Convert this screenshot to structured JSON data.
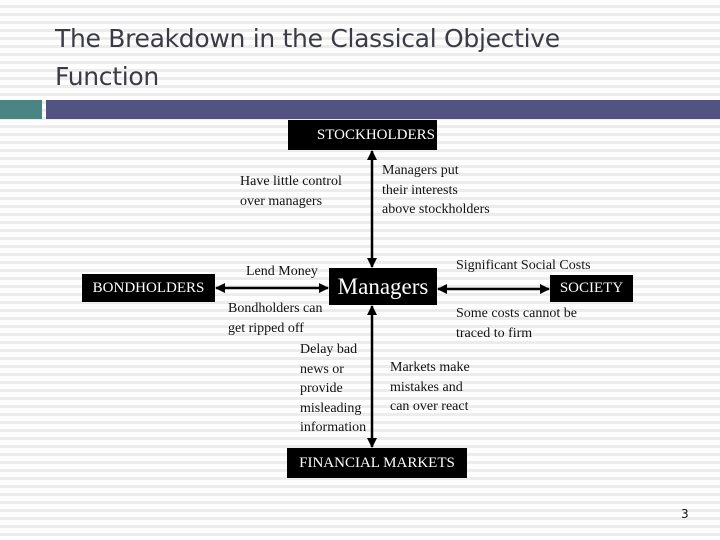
{
  "slide": {
    "title": "The Breakdown in the Classical Objective Function",
    "page_number": "3",
    "accent_colors": {
      "teal": "#4a8583",
      "purple": "#535383"
    }
  },
  "diagram": {
    "nodes": {
      "stockholders": "STOCKHOLDERS",
      "bondholders": "BONDHOLDERS",
      "managers": "Managers",
      "society": "SOCIETY",
      "financial_markets": "FINANCIAL MARKETS"
    },
    "labels": {
      "little_control": [
        "Have little control",
        "over managers"
      ],
      "managers_put": [
        "Managers put",
        "their interests",
        "above stockholders"
      ],
      "lend_money": "Lend Money",
      "ripped_off": [
        "Bondholders can",
        "get ripped off"
      ],
      "delay_bad": [
        "Delay bad",
        "news or",
        "provide",
        "misleading",
        "information"
      ],
      "social_costs": "Significant Social Costs",
      "some_costs": [
        "Some costs cannot be",
        "traced to firm"
      ],
      "markets_make": [
        "Markets make",
        "mistakes and",
        "can over react"
      ]
    },
    "edges": [
      {
        "from": "stockholders",
        "to": "managers",
        "type": "double-arrow"
      },
      {
        "from": "bondholders",
        "to": "managers",
        "type": "double-arrow"
      },
      {
        "from": "managers",
        "to": "society",
        "type": "double-arrow"
      },
      {
        "from": "managers",
        "to": "financial_markets",
        "type": "double-arrow"
      }
    ]
  }
}
